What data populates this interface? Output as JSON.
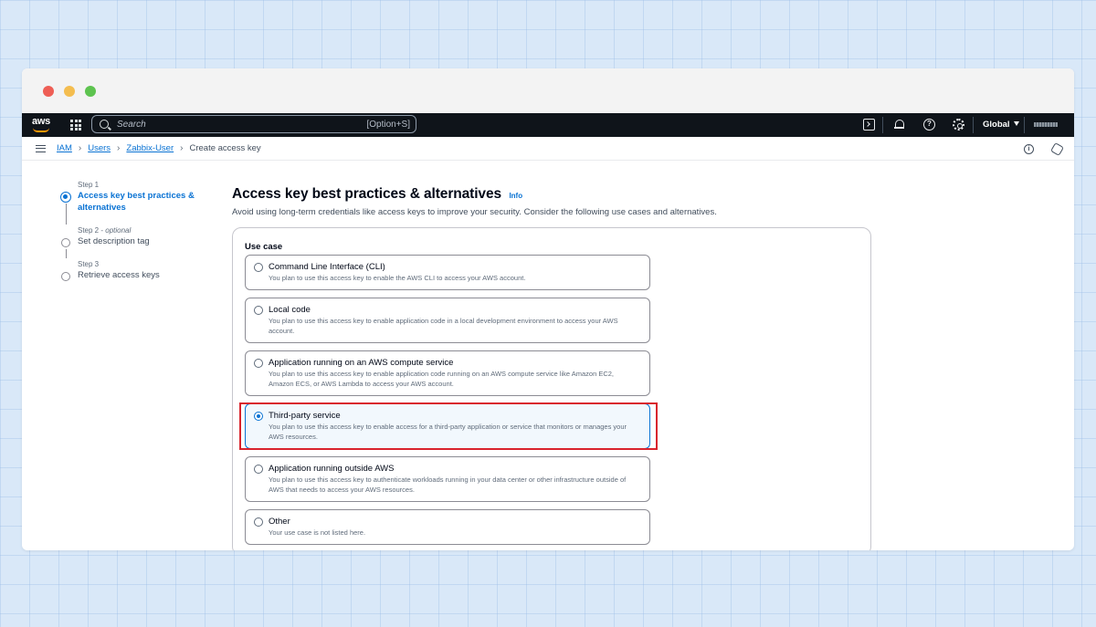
{
  "nav": {
    "logo_text": "aws",
    "search_placeholder": "Search",
    "search_shortcut": "[Option+S]",
    "region": "Global"
  },
  "breadcrumbs": {
    "iam": "IAM",
    "users": "Users",
    "user": "Zabbix-User",
    "current": "Create access key"
  },
  "steps": [
    {
      "num": "Step 1",
      "optional": "",
      "title": "Access key best practices & alternatives",
      "active": true
    },
    {
      "num": "Step 2",
      "optional": "optional",
      "title": "Set description tag",
      "active": false
    },
    {
      "num": "Step 3",
      "optional": "",
      "title": "Retrieve access keys",
      "active": false
    }
  ],
  "page": {
    "title": "Access key best practices & alternatives",
    "info": "Info",
    "description": "Avoid using long-term credentials like access keys to improve your security. Consider the following use cases and alternatives."
  },
  "use_case": {
    "label": "Use case",
    "options": [
      {
        "title": "Command Line Interface (CLI)",
        "description": "You plan to use this access key to enable the AWS CLI to access your AWS account.",
        "selected": false
      },
      {
        "title": "Local code",
        "description": "You plan to use this access key to enable application code in a local development environment to access your AWS account.",
        "selected": false
      },
      {
        "title": "Application running on an AWS compute service",
        "description": "You plan to use this access key to enable application code running on an AWS compute service like Amazon EC2, Amazon ECS, or AWS Lambda to access your AWS account.",
        "selected": false
      },
      {
        "title": "Third-party service",
        "description": "You plan to use this access key to enable access for a third-party application or service that monitors or manages your AWS resources.",
        "selected": true
      },
      {
        "title": "Application running outside AWS",
        "description": "You plan to use this access key to authenticate workloads running in your data center or other infrastructure outside of AWS that needs to access your AWS resources.",
        "selected": false
      },
      {
        "title": "Other",
        "description": "Your use case is not listed here.",
        "selected": false
      }
    ]
  },
  "colors": {
    "accent": "#0972d3",
    "nav_bg": "#0f141a",
    "highlight": "#d9232d"
  }
}
